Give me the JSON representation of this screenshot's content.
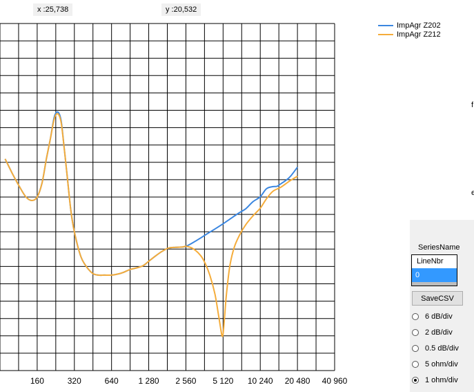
{
  "cursor": {
    "x_readout": "x :25,738",
    "y_readout": "y :20,532"
  },
  "legend": [
    {
      "name": "ImpAgr Z202",
      "color": "#3a86e0"
    },
    {
      "name": "ImpAgr Z212",
      "color": "#f5ac3a"
    }
  ],
  "panel": {
    "series_label": "SeriesName",
    "list_header": "LineNbr",
    "list_selected": "0",
    "save_label": "SaveCSV",
    "radios": [
      {
        "label": "6 dB/div",
        "selected": false
      },
      {
        "label": "2 dB/div",
        "selected": false
      },
      {
        "label": "0.5 dB/div",
        "selected": false
      },
      {
        "label": "5 ohm/div",
        "selected": false
      },
      {
        "label": "1 ohm/div",
        "selected": true
      }
    ]
  },
  "edge_marks": [
    "f",
    "e"
  ],
  "chart_data": {
    "type": "line",
    "x_scale": "log2",
    "xlim": [
      80,
      40960
    ],
    "x_ticks": [
      "160",
      "320",
      "640",
      "1 280",
      "2 560",
      "5 120",
      "10 240",
      "20 480",
      "40 960"
    ],
    "x_tick_values": [
      160,
      320,
      640,
      1280,
      2560,
      5120,
      10240,
      20480,
      40960
    ],
    "ylim": [
      0,
      100
    ],
    "y_grid_lines": 20,
    "grid": true,
    "legend_position": "top-right",
    "series": [
      {
        "name": "ImpAgr Z202",
        "color": "#3a86e0",
        "x": [
          88,
          100,
          115,
          130,
          145,
          160,
          175,
          190,
          205,
          220,
          235,
          250,
          265,
          280,
          300,
          320,
          360,
          400,
          450,
          500,
          560,
          640,
          720,
          800,
          900,
          1000,
          1150,
          1280,
          1450,
          1650,
          1850,
          2100,
          2400,
          2560,
          2900,
          3300,
          3800,
          4400,
          5120,
          5900,
          6800,
          7800,
          8900,
          10240,
          11500,
          13000,
          14000,
          15000,
          16500,
          18000,
          20480
        ],
        "y": [
          61,
          57,
          53,
          50,
          49,
          50,
          54,
          61,
          67,
          73,
          74.5,
          72,
          64,
          56,
          46,
          40,
          33,
          30,
          28,
          27.5,
          27.5,
          27.5,
          27.8,
          28.3,
          29.1,
          29.5,
          30.2,
          31.5,
          33.0,
          34.4,
          35.3,
          35.5,
          35.6,
          35.8,
          36.8,
          38.0,
          39.4,
          40.8,
          42.3,
          43.8,
          45.3,
          46.6,
          48.6,
          50.1,
          52.4,
          53.0,
          53.1,
          53.8,
          54.8,
          56.0,
          58.6
        ]
      },
      {
        "name": "ImpAgr Z212",
        "color": "#f5ac3a",
        "x": [
          88,
          100,
          115,
          130,
          145,
          160,
          175,
          190,
          205,
          220,
          235,
          250,
          265,
          280,
          300,
          320,
          360,
          400,
          450,
          500,
          560,
          640,
          720,
          800,
          900,
          1000,
          1150,
          1280,
          1450,
          1650,
          1850,
          2100,
          2400,
          2560,
          2900,
          3300,
          3600,
          4000,
          4400,
          4700,
          4900,
          5020,
          5120,
          5250,
          5450,
          5800,
          6300,
          7000,
          7800,
          8900,
          10240,
          11500,
          13000,
          15000,
          17500,
          20480
        ],
        "y": [
          61,
          57,
          53,
          50,
          49,
          50,
          54,
          61,
          67,
          72.5,
          74,
          71.5,
          64,
          56,
          46,
          40,
          33,
          30,
          28,
          27.5,
          27.5,
          27.5,
          27.8,
          28.3,
          29.1,
          29.5,
          30.2,
          31.5,
          33.0,
          34.4,
          35.3,
          35.5,
          35.6,
          35.8,
          35.2,
          33.5,
          31.5,
          27.5,
          22,
          16,
          12,
          10,
          10.5,
          15,
          22,
          30,
          35.5,
          39.2,
          42,
          44.5,
          46.8,
          49.5,
          51.7,
          52.8,
          54.5,
          56
        ]
      }
    ]
  }
}
